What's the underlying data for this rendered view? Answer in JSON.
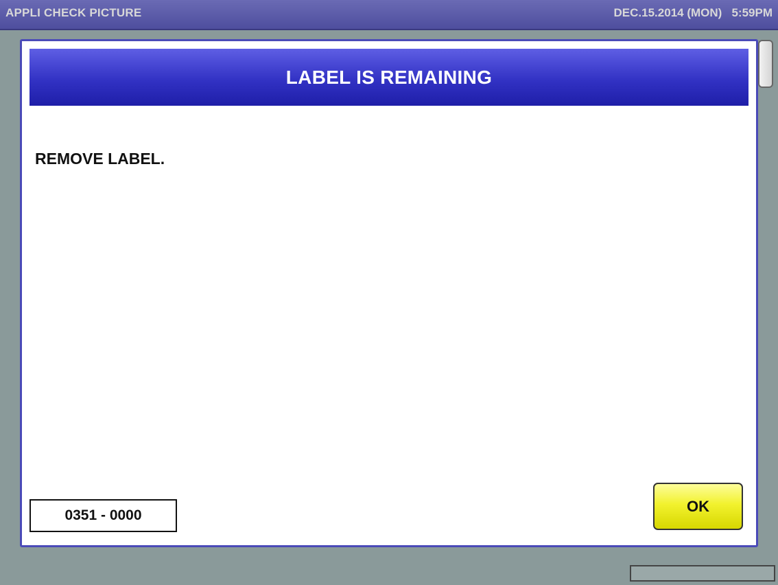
{
  "header": {
    "app_title": "APPLI CHECK PICTURE",
    "datetime": "DEC.15.2014 (MON)   5:59PM"
  },
  "dialog": {
    "title": "LABEL IS REMAINING",
    "message": "REMOVE LABEL.",
    "code": "0351 - 0000",
    "ok_label": "OK"
  },
  "colors": {
    "title_bar": "#5a5aa8",
    "dialog_header": "#3232c4",
    "dialog_border": "#4a4ab8",
    "ok_button": "#f2f22e",
    "background": "#8a9a9a"
  }
}
